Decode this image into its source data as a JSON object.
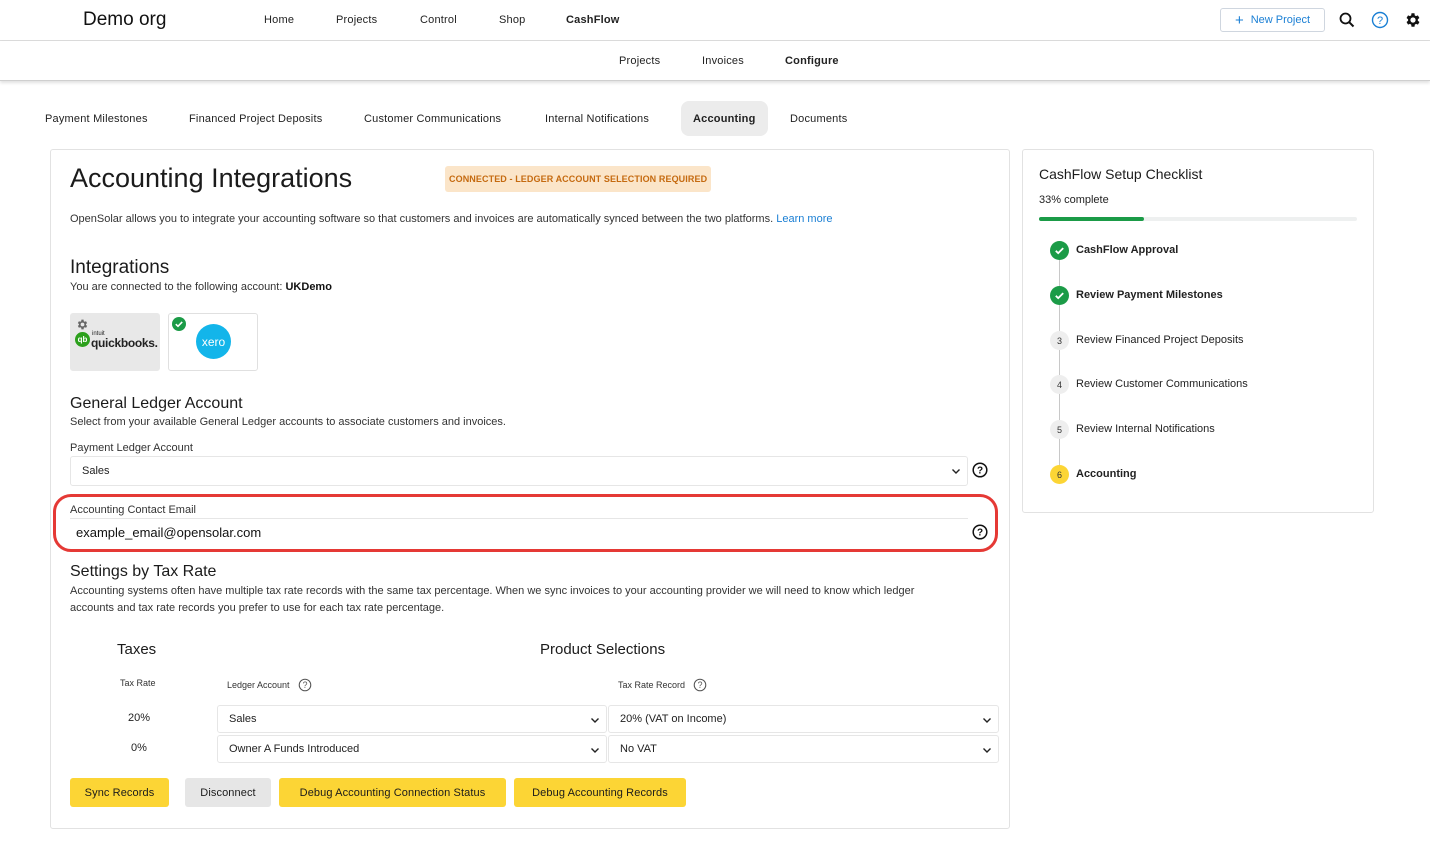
{
  "header": {
    "org": "Demo org",
    "nav": [
      "Home",
      "Projects",
      "Control",
      "Shop",
      "CashFlow"
    ],
    "new_project": "New Project"
  },
  "subnav": [
    "Projects",
    "Invoices",
    "Configure"
  ],
  "tabs": [
    "Payment Milestones",
    "Financed Project Deposits",
    "Customer Communications",
    "Internal Notifications",
    "Accounting",
    "Documents"
  ],
  "main": {
    "title": "Accounting Integrations",
    "status_badge": "CONNECTED - LEDGER ACCOUNT SELECTION REQUIRED",
    "intro": "OpenSolar allows you to integrate your accounting software so that customers and invoices are automatically synced between the two platforms.",
    "learn_more": "Learn more",
    "integrations_title": "Integrations",
    "connected_prefix": "You are connected to the following account:",
    "connected_account": "UKDemo",
    "providers": {
      "quickbooks_sub": "intuit",
      "quickbooks": "quickbooks.",
      "xero": "xero"
    },
    "gl_title": "General Ledger Account",
    "gl_desc": "Select from your available General Ledger accounts to associate customers and invoices.",
    "payment_ledger_label": "Payment Ledger Account",
    "payment_ledger_value": "Sales",
    "email_label": "Accounting Contact Email",
    "email_value": "example_email@opensolar.com",
    "tax_title": "Settings by Tax Rate",
    "tax_desc_1": "Accounting systems often have multiple tax rate records with the same tax percentage. When we sync invoices to your accounting provider we will need to know which ledger",
    "tax_desc_2": "accounts and tax rate records you prefer to use for each tax rate percentage.",
    "taxes_heading": "Taxes",
    "product_heading": "Product Selections",
    "col_tax_rate": "Tax Rate",
    "col_ledger": "Ledger Account",
    "col_record": "Tax Rate Record",
    "rows": [
      {
        "rate": "20%",
        "ledger": "Sales",
        "record": "20% (VAT on Income)"
      },
      {
        "rate": "0%",
        "ledger": "Owner A Funds Introduced",
        "record": "No VAT"
      }
    ],
    "buttons": {
      "sync": "Sync Records",
      "disconnect": "Disconnect",
      "debug_status": "Debug Accounting Connection Status",
      "debug_records": "Debug Accounting Records"
    }
  },
  "checklist": {
    "title": "CashFlow Setup Checklist",
    "progress_label": "33% complete",
    "progress": 0.33,
    "steps": [
      {
        "num": "",
        "label": "CashFlow Approval",
        "state": "done"
      },
      {
        "num": "",
        "label": "Review Payment Milestones",
        "state": "done"
      },
      {
        "num": "3",
        "label": "Review Financed Project Deposits",
        "state": "todo"
      },
      {
        "num": "4",
        "label": "Review Customer Communications",
        "state": "todo"
      },
      {
        "num": "5",
        "label": "Review Internal Notifications",
        "state": "todo"
      },
      {
        "num": "6",
        "label": "Accounting",
        "state": "current"
      }
    ]
  },
  "colors": {
    "accent": "#1a7fd4",
    "yellow": "#fcd535",
    "success": "#1b9b47",
    "warning_bg": "#fbe5c9",
    "warning_text": "#c56a10",
    "highlight": "#e53935"
  }
}
